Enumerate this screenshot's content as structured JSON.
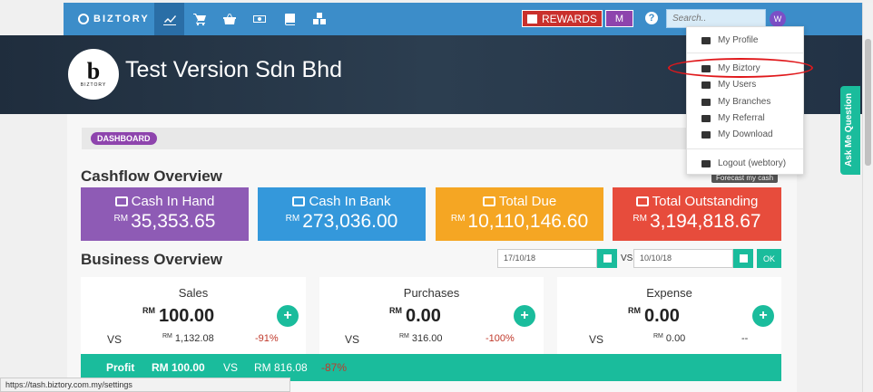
{
  "nav": {
    "brand": "BIZTORY",
    "rewards": "REWARDS",
    "m_badge": "M",
    "help": "?",
    "search_placeholder": "Search..",
    "avatar": "W"
  },
  "header": {
    "company": "Test Version Sdn Bhd"
  },
  "breadcrumb": "DASHBOARD",
  "cashflow": {
    "title": "Cashflow Overview",
    "forecast": "Forecast my cash",
    "stats": [
      {
        "label": "Cash In Hand",
        "currency": "RM",
        "value": "35,353.65",
        "color": "#8e5bb5"
      },
      {
        "label": "Cash In Bank",
        "currency": "RM",
        "value": "273,036.00",
        "color": "#3498db"
      },
      {
        "label": "Total Due",
        "currency": "RM",
        "value": "10,110,146.60",
        "color": "#f5a623"
      },
      {
        "label": "Total Outstanding",
        "currency": "RM",
        "value": "3,194,818.67",
        "color": "#e74c3c"
      }
    ]
  },
  "business": {
    "title": "Business Overview",
    "date_from": "17/10/18",
    "vs": "VS",
    "date_to": "10/10/18",
    "ok": "OK",
    "panels": [
      {
        "title": "Sales",
        "currency": "RM",
        "value": "100.00",
        "vs": "VS",
        "cmp_currency": "RM",
        "cmp": "1,132.08",
        "pct": "-91%"
      },
      {
        "title": "Purchases",
        "currency": "RM",
        "value": "0.00",
        "vs": "VS",
        "cmp_currency": "RM",
        "cmp": "316.00",
        "pct": "-100%"
      },
      {
        "title": "Expense",
        "currency": "RM",
        "value": "0.00",
        "vs": "VS",
        "cmp_currency": "RM",
        "cmp": "0.00",
        "pct": "--"
      }
    ],
    "profit": {
      "label": "Profit",
      "value": "RM 100.00",
      "vs": "VS",
      "cmp": "RM 816.08",
      "pct": "-87%"
    }
  },
  "dropdown": {
    "items": [
      "My Profile",
      "My Biztory",
      "My Users",
      "My Branches",
      "My Referral",
      "My Download"
    ],
    "logout": "Logout (webtory)"
  },
  "askme": "Ask Me Question",
  "status_url": "https://tash.biztory.com.my/settings"
}
